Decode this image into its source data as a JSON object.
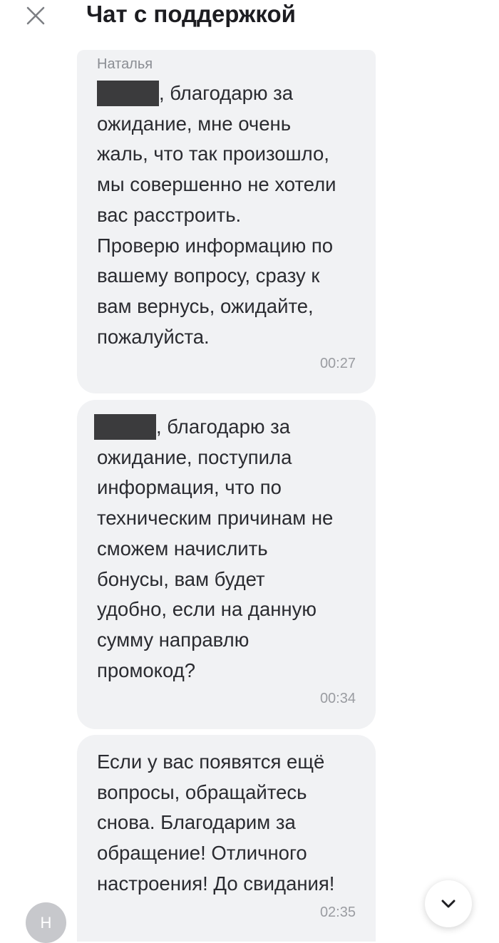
{
  "header": {
    "title": "Чат с поддержкой",
    "close_icon": "close-icon"
  },
  "messages": [
    {
      "sender": "Наталья",
      "redacted_name": true,
      "text_after_redaction": ", благодарю за",
      "text": "ожидание, мне очень\nжаль, что так произошло,\nмы совершенно не хотели\nвас расстроить.\nПроверю информацию по\nвашему вопросу, сразу к\nвам вернусь, ожидайте,\nпожалуйста.",
      "time": "00:27"
    },
    {
      "redacted_name": true,
      "text_after_redaction": ", благодарю за",
      "text": "ожидание, поступила\nинформация, что по\nтехническим причинам не\nсможем начислить\nбонусы, вам будет\nудобно, если на данную\nсумму направлю\nпромокод?",
      "time": "00:34"
    },
    {
      "text": "Если у вас появятся ещё\nвопросы, обращайтесь\nснова. Благодарим за\nобращение! Отличного\nнастроения! До свидания!",
      "time": "02:35"
    }
  ],
  "avatar": {
    "initial": "Н"
  },
  "scroll_down_icon": "chevron-down-icon",
  "colors": {
    "bubble": "#f1f2f4",
    "avatar": "#c7c8cc",
    "redaction": "#3b3b3d"
  }
}
